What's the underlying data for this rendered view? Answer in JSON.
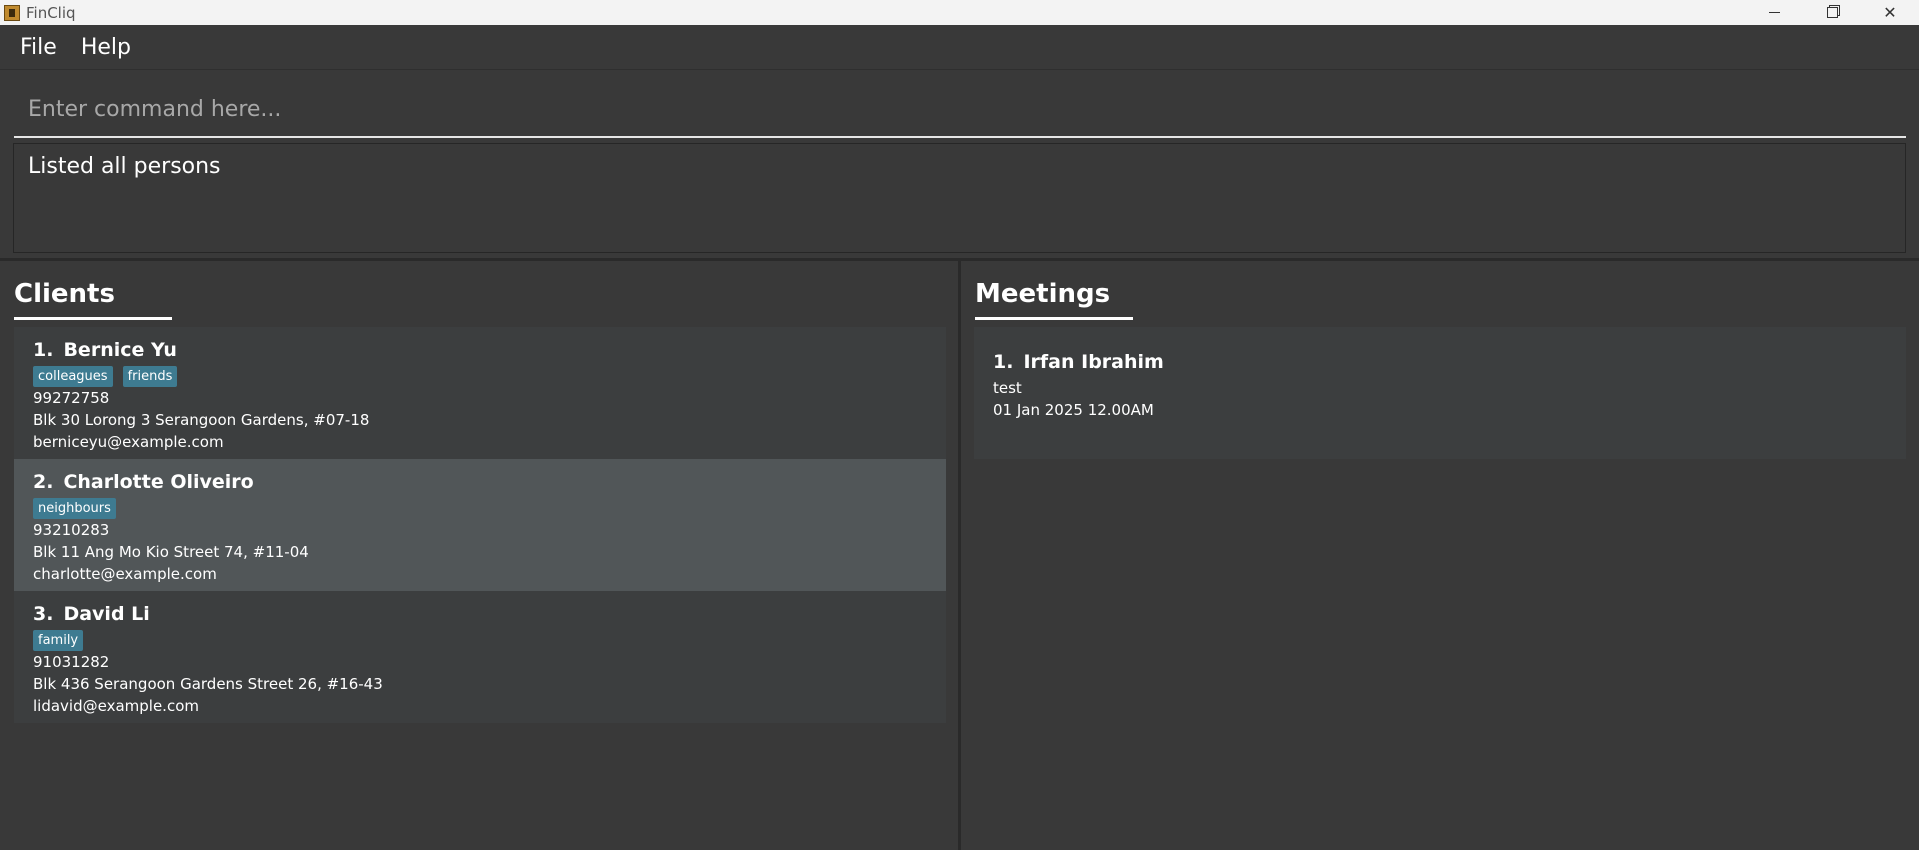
{
  "window": {
    "title": "FinCliq",
    "controls": [
      "minimize",
      "maximize",
      "close"
    ]
  },
  "menu": {
    "items": [
      {
        "label": "File"
      },
      {
        "label": "Help"
      }
    ]
  },
  "command": {
    "placeholder": "Enter command here...",
    "value": ""
  },
  "result": {
    "text": "Listed all persons"
  },
  "clients": {
    "title": "Clients",
    "items": [
      {
        "index": "1.",
        "name": "Bernice Yu",
        "tags": [
          "colleagues",
          "friends"
        ],
        "phone": "99272758",
        "address": "Blk 30 Lorong 3 Serangoon Gardens, #07-18",
        "email": "berniceyu@example.com",
        "selected": false
      },
      {
        "index": "2.",
        "name": "Charlotte Oliveiro",
        "tags": [
          "neighbours"
        ],
        "phone": "93210283",
        "address": "Blk 11 Ang Mo Kio Street 74, #11-04",
        "email": "charlotte@example.com",
        "selected": true
      },
      {
        "index": "3.",
        "name": "David Li",
        "tags": [
          "family"
        ],
        "phone": "91031282",
        "address": "Blk 436 Serangoon Gardens Street 26, #16-43",
        "email": "lidavid@example.com",
        "selected": false
      }
    ]
  },
  "meetings": {
    "title": "Meetings",
    "items": [
      {
        "index": "1.",
        "name": "Irfan Ibrahim",
        "description": "test",
        "datetime": "01 Jan 2025 12.00AM"
      }
    ]
  },
  "colors": {
    "background": "#393939",
    "card": "#3c3e3f",
    "card_selected": "#515658",
    "tag": "#3e7b91",
    "titlebar": "#f3f3f3"
  }
}
